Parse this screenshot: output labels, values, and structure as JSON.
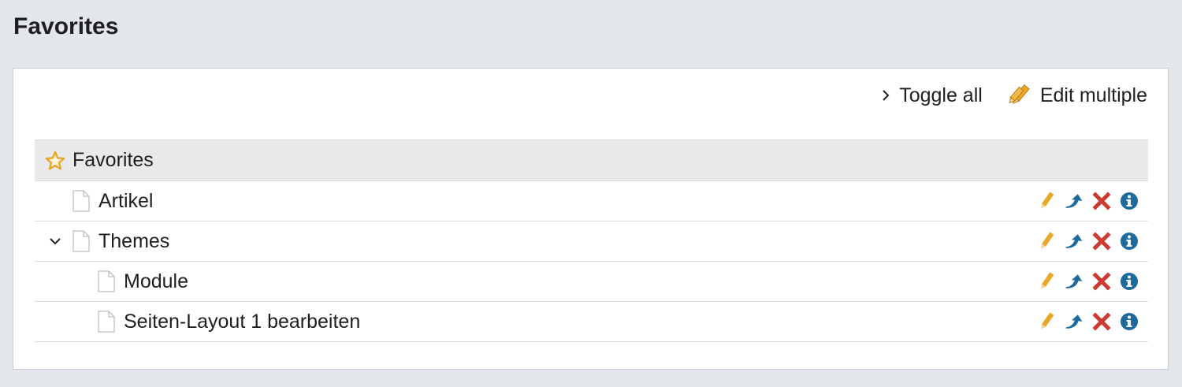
{
  "page": {
    "title": "Favorites"
  },
  "toolbar": {
    "toggle_all_label": "Toggle all",
    "edit_multiple_label": "Edit multiple",
    "toggle_icon": "chevron-right-icon",
    "edit_icon": "pencils-icon"
  },
  "tree": {
    "root": {
      "label": "Favorites",
      "icon": "star-icon"
    },
    "items": [
      {
        "label": "Artikel",
        "icon": "document-icon",
        "level": 1,
        "expanded": null
      },
      {
        "label": "Themes",
        "icon": "document-icon",
        "level": 1,
        "expanded": true
      },
      {
        "label": "Module",
        "icon": "document-icon",
        "level": 2,
        "expanded": null
      },
      {
        "label": "Seiten-Layout 1 bearbeiten",
        "icon": "document-icon",
        "level": 2,
        "expanded": null
      }
    ],
    "row_actions": [
      "edit-icon",
      "move-icon",
      "delete-icon",
      "info-icon"
    ]
  },
  "colors": {
    "background": "#e3e6ea",
    "panel": "#ffffff",
    "header_row": "#e8e9eb",
    "pencil": "#e8a727",
    "move": "#1e6a9c",
    "delete": "#cc3a32",
    "info": "#1e6a9c",
    "star": "#e8a727"
  }
}
